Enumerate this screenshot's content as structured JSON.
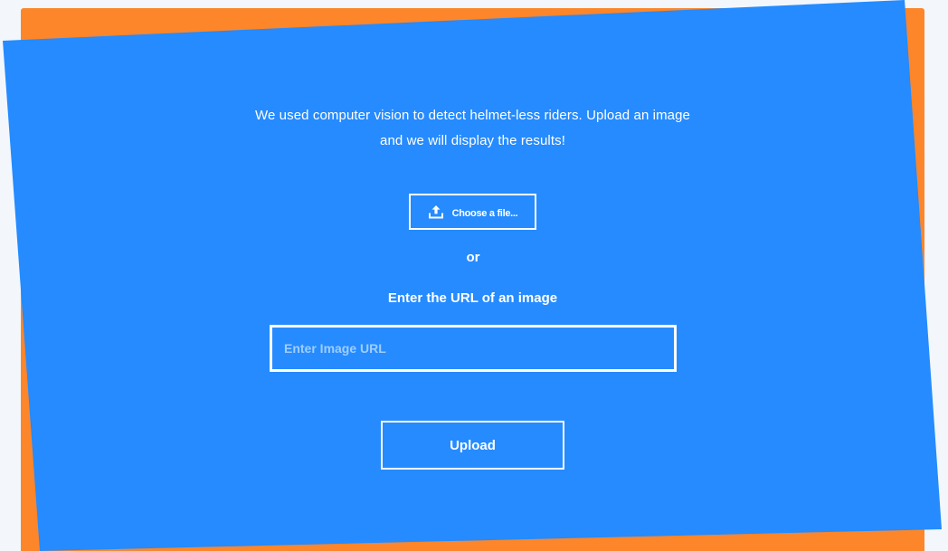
{
  "intro": {
    "line1": "We used computer vision to detect helmet-less riders. Upload an image",
    "line2": "and we will display the results!"
  },
  "file_picker": {
    "icon": "upload-icon",
    "label": "Choose a file..."
  },
  "separator": "or",
  "url_section": {
    "label": "Enter the URL of an image",
    "placeholder": "Enter Image URL",
    "value": ""
  },
  "upload_button": {
    "label": "Upload"
  },
  "colors": {
    "background": "#f3f7fc",
    "accent_orange": "#fd862a",
    "primary_blue": "#258bff",
    "text": "#ffffff",
    "placeholder": "#9fcdff"
  }
}
